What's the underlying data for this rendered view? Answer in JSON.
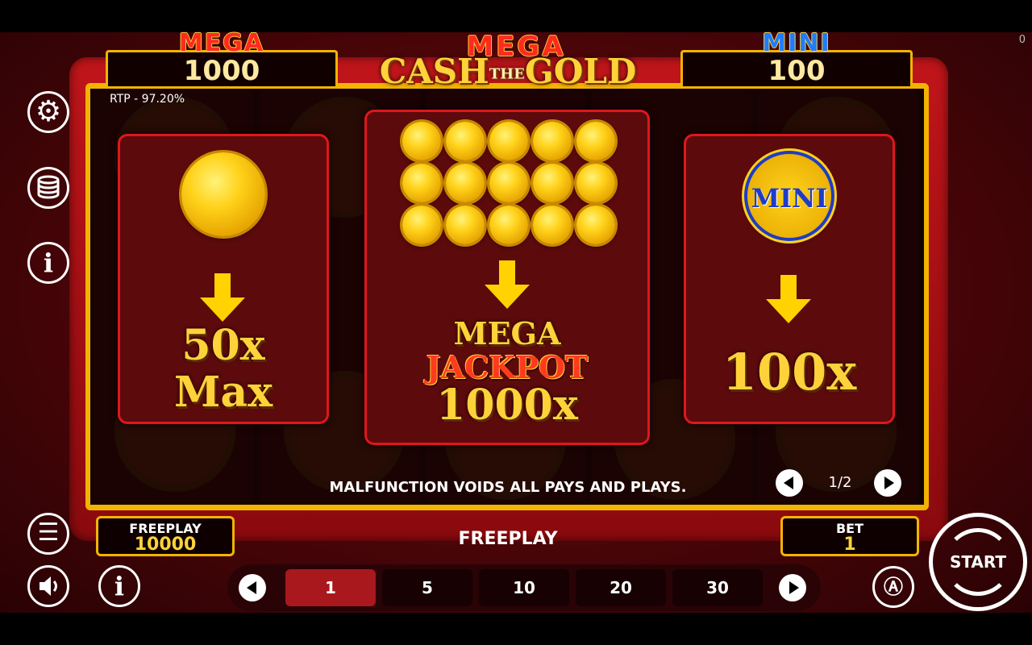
{
  "status": {
    "corner_value": "0"
  },
  "jackpots": {
    "left": {
      "title": "MEGA",
      "value": "1000"
    },
    "right": {
      "title": "MINI",
      "value": "100"
    }
  },
  "logo": {
    "top": "MEGA",
    "cash": "CASH",
    "the": "THE",
    "gold": "GOLD"
  },
  "rtp": "RTP - 97.20%",
  "panels": {
    "left": {
      "line1": "50x",
      "line2": "Max"
    },
    "center": {
      "line1": "MEGA",
      "line2": "JACKPOT",
      "line3": "1000x"
    },
    "right": {
      "coin_label": "MINI",
      "value": "100x"
    }
  },
  "notice": "MALFUNCTION VOIDS ALL PAYS AND PLAYS.",
  "pager": {
    "label": "1/2"
  },
  "freeplay_box": {
    "label": "FREEPLAY",
    "value": "10000"
  },
  "mode_label": "FREEPLAY",
  "bet_box": {
    "label": "BET",
    "value": "1"
  },
  "bet_options": [
    "1",
    "5",
    "10",
    "20",
    "30"
  ],
  "selected_bet": "1",
  "start_label": "START",
  "icons": [
    "gear-icon",
    "coins-stack-icon",
    "info-icon",
    "menu-icon",
    "speaker-icon",
    "info-icon",
    "autoplay-icon",
    "start-icon"
  ]
}
